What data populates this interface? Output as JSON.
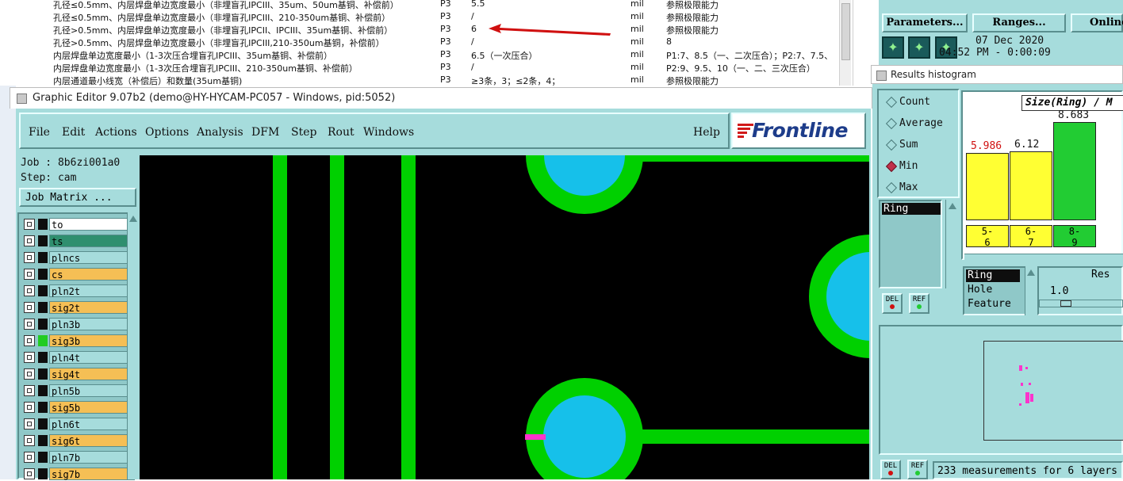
{
  "spreadsheet": {
    "rows": [
      {
        "desc": "孔径≤0.5mm、内层焊盘单边宽度最小（非埋盲孔IPCIII、35um、50um基铜、补偿前）",
        "cls": "P3",
        "value": "5.5",
        "unit": "mil",
        "note": "参照极限能力"
      },
      {
        "desc": "孔径≤0.5mm、内层焊盘单边宽度最小（非埋盲孔IPCIII、210-350um基铜、补偿前）",
        "cls": "P3",
        "value": "/",
        "unit": "mil",
        "note": "参照极限能力"
      },
      {
        "desc": "孔径>0.5mm、内层焊盘单边宽度最小（非埋盲孔IPCII、IPCIII、35um基铜、补偿前）",
        "cls": "P3",
        "value": "6",
        "unit": "mil",
        "note": "参照极限能力"
      },
      {
        "desc": "孔径>0.5mm、内层焊盘单边宽度最小（非埋盲孔IPCIII,210-350um基铜，补偿前）",
        "cls": "P3",
        "value": "/",
        "unit": "mil",
        "note": "8"
      },
      {
        "desc": "内层焊盘单边宽度最小（1-3次压合埋盲孔IPCIII、35um基铜、补偿前）",
        "cls": "P3",
        "value": "6.5（一次压合）",
        "unit": "mil",
        "note": "P1:7、8.5（一、二次压合）；P2:7、7.5、"
      },
      {
        "desc": "内层焊盘单边宽度最小（1-3次压合埋盲孔IPCIII、210-350um基铜、补偿前）",
        "cls": "P3",
        "value": "/",
        "unit": "mil",
        "note": "P2:9、9.5、10（一、二、三次压合）"
      },
      {
        "desc": "内层通道最小线宽（补偿后）和数量(35um基铜)",
        "cls": "P3",
        "value": "≥3条，3；≤2条，4；",
        "unit": "mil",
        "note": "参照极限能力"
      }
    ]
  },
  "editor": {
    "title": "Graphic Editor 9.07b2 (demo@HY-HYCAM-PC057 - Windows, pid:5052)",
    "menu": [
      "File",
      "Edit",
      "Actions",
      "Options",
      "Analysis",
      "DFM",
      "Step",
      "Rout",
      "Windows"
    ],
    "help": "Help",
    "logo": "Frontline",
    "job_label": "Job : 8b6zi001a0",
    "step_label": "Step: cam",
    "job_matrix": "Job Matrix ...",
    "layers": [
      {
        "name": "to",
        "color": "#ffffff",
        "swatch": "#0e0e0e"
      },
      {
        "name": "ts",
        "color": "#2f8f6f",
        "swatch": "#0e0e0e"
      },
      {
        "name": "plncs",
        "color": "#a6dcdc",
        "swatch": "#0e0e0e"
      },
      {
        "name": "cs",
        "color": "#f5bf55",
        "swatch": "#0e0e0e"
      },
      {
        "name": "pln2t",
        "color": "#a6dcdc",
        "swatch": "#0e0e0e"
      },
      {
        "name": "sig2t",
        "color": "#f5bf55",
        "swatch": "#0e0e0e"
      },
      {
        "name": "pln3b",
        "color": "#a6dcdc",
        "swatch": "#0e0e0e"
      },
      {
        "name": "sig3b",
        "color": "#f5bf55",
        "swatch": "#22cc22"
      },
      {
        "name": "pln4t",
        "color": "#a6dcdc",
        "swatch": "#0e0e0e"
      },
      {
        "name": "sig4t",
        "color": "#f5bf55",
        "swatch": "#0e0e0e"
      },
      {
        "name": "pln5b",
        "color": "#a6dcdc",
        "swatch": "#0e0e0e"
      },
      {
        "name": "sig5b",
        "color": "#f5bf55",
        "swatch": "#0e0e0e"
      },
      {
        "name": "pln6t",
        "color": "#a6dcdc",
        "swatch": "#0e0e0e"
      },
      {
        "name": "sig6t",
        "color": "#f5bf55",
        "swatch": "#0e0e0e"
      },
      {
        "name": "pln7b",
        "color": "#a6dcdc",
        "swatch": "#0e0e0e"
      },
      {
        "name": "sig7b",
        "color": "#f5bf55",
        "swatch": "#0e0e0e"
      }
    ]
  },
  "top_right": {
    "buttons": [
      "Parameters...",
      "Ranges...",
      "Online"
    ],
    "date": "07 Dec 2020",
    "time": "04:52 PM - 0:00:09"
  },
  "histogram": {
    "title": "Results histogram",
    "stats": [
      {
        "label": "Count",
        "selected": false
      },
      {
        "label": "Average",
        "selected": false
      },
      {
        "label": "Sum",
        "selected": false
      },
      {
        "label": "Min",
        "selected": true
      },
      {
        "label": "Max",
        "selected": false
      }
    ],
    "metric_selected": "Ring",
    "chart_title": "Size(Ring) / M",
    "bars": [
      {
        "value": "5.986",
        "category": "5-\n6",
        "color": "#ffff33",
        "value_color": "#d01010"
      },
      {
        "value": "6.12",
        "category": "6-\n7",
        "color": "#ffff33",
        "value_color": "#111111"
      },
      {
        "value": "8.683",
        "category": "8-\n9",
        "color": "#22cc33",
        "value_color": "#111111"
      }
    ],
    "types": [
      "Ring",
      "Hole",
      "Feature"
    ],
    "res_label": "Res",
    "res_value": "1.0",
    "del_label": "DEL",
    "ref_label": "REF",
    "measurements": "233 measurements for 6 layers"
  }
}
